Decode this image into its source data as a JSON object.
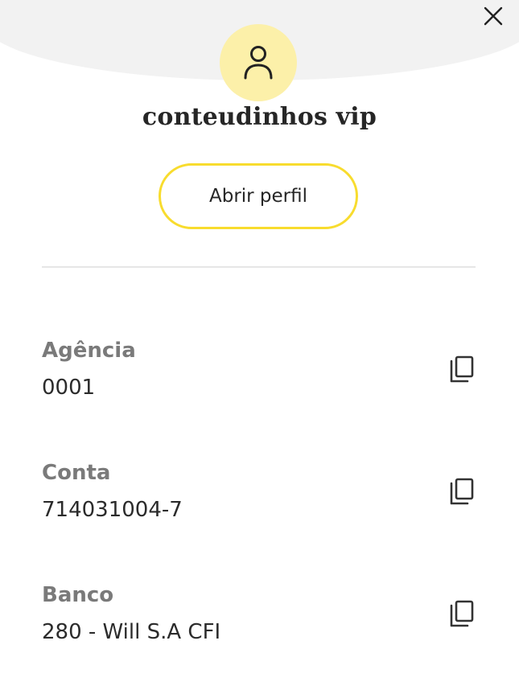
{
  "profile": {
    "name": "conteudinhos vip",
    "open_profile_label": "Abrir perfil",
    "avatar_icon": "person-icon",
    "avatar_color": "#fcf0a9",
    "accent_color": "#f8dc2e"
  },
  "header": {
    "close_icon": "close-icon"
  },
  "account_info": [
    {
      "label": "Agência",
      "value": "0001",
      "action_icon": "copy-icon"
    },
    {
      "label": "Conta",
      "value": "714031004-7",
      "action_icon": "copy-icon"
    },
    {
      "label": "Banco",
      "value": "280 - Will S.A CFI",
      "action_icon": "copy-icon"
    }
  ]
}
